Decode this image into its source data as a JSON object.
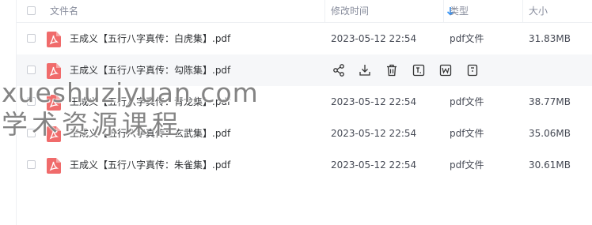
{
  "columns": {
    "name": "文件名",
    "modified": "修改时间",
    "type": "类型",
    "size": "大小"
  },
  "sort": {
    "column": "modified",
    "direction": "descending",
    "icon": "arrow-down-icon"
  },
  "files": [
    {
      "name": "王成义【五行八字真传：白虎集】.pdf",
      "modified": "2023-05-12 22:54",
      "type": "pdf文件",
      "size": "31.83MB"
    },
    {
      "name": "王成义【五行八字真传：勾陈集】.pdf",
      "modified": "",
      "type": "",
      "size": ""
    },
    {
      "name": "王成义【五行八字真传：青龙集】.pdf",
      "modified": "2023-05-12 22:54",
      "type": "pdf文件",
      "size": "38.77MB"
    },
    {
      "name": "王成义【五行八字真传：玄武集】.pdf",
      "modified": "2023-05-12 22:54",
      "type": "pdf文件",
      "size": "35.06MB"
    },
    {
      "name": "王成义【五行八字真传：朱雀集】.pdf",
      "modified": "2023-05-12 22:54",
      "type": "pdf文件",
      "size": "30.61MB"
    }
  ],
  "hover_row_actions": [
    "share-icon",
    "download-icon",
    "delete-icon",
    "text-extract-icon",
    "word-convert-icon",
    "more-tools-icon"
  ],
  "watermark": {
    "line1": "xueshuziyuan.com",
    "line2": "学术资源课程"
  },
  "colors": {
    "pdf_icon": "#f06b6b",
    "sort_arrow": "#2f8ff5",
    "hover_row": "#f6f7f9",
    "header_text": "#878c9c"
  }
}
